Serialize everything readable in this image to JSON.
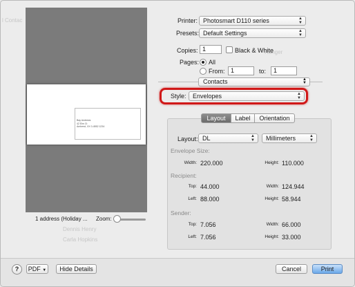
{
  "background": {
    "left_top": "l Contac",
    "left_items": [
      "Dennis Henry",
      "Carla Hopkins"
    ],
    "right_items": [
      "Ranger"
    ]
  },
  "preview": {
    "envelope_address_lines": [
      "Bay Andrews",
      "42 Elm Ct",
      "Amherst, XX 0-4552 1234"
    ],
    "selection_summary": "1 address (Holiday ...",
    "zoom_label": "Zoom:",
    "zoom_level": 0.0
  },
  "printer": {
    "label": "Printer:",
    "value": "Photosmart D110 series"
  },
  "presets": {
    "label": "Presets:",
    "value": "Default Settings"
  },
  "copies": {
    "label": "Copies:",
    "value": "1",
    "bw_label": "Black & White",
    "bw_checked": false
  },
  "pages": {
    "label": "Pages:",
    "all_label": "All",
    "from_label": "From:",
    "from_value": "1",
    "to_label": "to:",
    "to_value": "1",
    "selected": "All"
  },
  "section": {
    "value": "Contacts"
  },
  "style": {
    "label": "Style:",
    "value": "Envelopes"
  },
  "tabs": [
    {
      "label": "Layout",
      "selected": true
    },
    {
      "label": "Label",
      "selected": false
    },
    {
      "label": "Orientation",
      "selected": false
    }
  ],
  "layout": {
    "label": "Layout:",
    "size_value": "DL",
    "unit_value": "Millimeters",
    "envelope_size": {
      "title": "Envelope Size:",
      "width_label": "Width:",
      "width": "220.000",
      "height_label": "Height:",
      "height": "110.000"
    },
    "recipient": {
      "title": "Recipient:",
      "top_label": "Top:",
      "top": "44.000",
      "width_label": "Width:",
      "width": "124.944",
      "left_label": "Left:",
      "left": "88.000",
      "height_label": "Height:",
      "height": "58.944"
    },
    "sender": {
      "title": "Sender:",
      "top_label": "Top:",
      "top": "7.056",
      "width_label": "Width:",
      "width": "66.000",
      "left_label": "Left:",
      "left": "7.056",
      "height_label": "Height:",
      "height": "33.000"
    }
  },
  "footer": {
    "help": "?",
    "pdf_label": "PDF",
    "hide_details": "Hide Details",
    "cancel": "Cancel",
    "print": "Print"
  },
  "colors": {
    "highlight_ring": "#d01818",
    "default_button": "#6aa8e8",
    "preview_bg": "#7b7b7b"
  }
}
